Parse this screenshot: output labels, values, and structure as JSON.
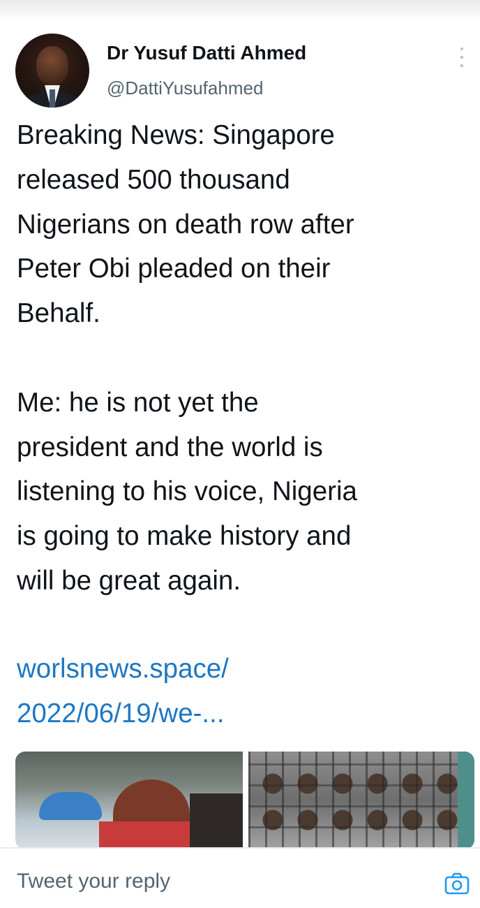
{
  "author": {
    "name": "Dr Yusuf Datti Ahmed",
    "handle": "@DattiYusufahmed"
  },
  "tweet": {
    "text": "Breaking News: Singapore\nreleased 500 thousand\nNigerians on death row after\nPeter Obi pleaded on their\nBehalf.\n\nMe: he is not yet the\npresident and the world is\nlistening to his voice, Nigeria\nis going to make history and\nwill be great again.",
    "link": "worlsnews.space/\n2022/06/19/we-..."
  },
  "reply": {
    "placeholder": "Tweet your reply"
  },
  "colors": {
    "link": "#1d77c4",
    "secondary_text": "#536471",
    "camera_icon": "#1d9bf0"
  },
  "icons": [
    "more-options-icon",
    "camera-icon"
  ]
}
